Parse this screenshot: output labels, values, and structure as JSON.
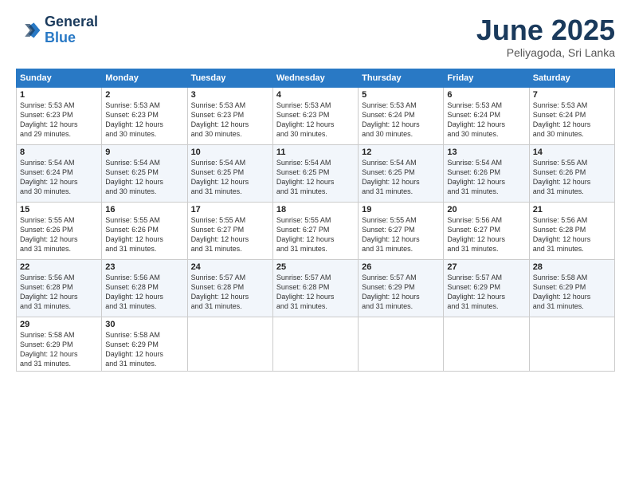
{
  "header": {
    "logo_line1": "General",
    "logo_line2": "Blue",
    "month": "June 2025",
    "location": "Peliyagoda, Sri Lanka"
  },
  "weekdays": [
    "Sunday",
    "Monday",
    "Tuesday",
    "Wednesday",
    "Thursday",
    "Friday",
    "Saturday"
  ],
  "weeks": [
    [
      {
        "day": "1",
        "info": "Sunrise: 5:53 AM\nSunset: 6:23 PM\nDaylight: 12 hours\nand 29 minutes."
      },
      {
        "day": "2",
        "info": "Sunrise: 5:53 AM\nSunset: 6:23 PM\nDaylight: 12 hours\nand 30 minutes."
      },
      {
        "day": "3",
        "info": "Sunrise: 5:53 AM\nSunset: 6:23 PM\nDaylight: 12 hours\nand 30 minutes."
      },
      {
        "day": "4",
        "info": "Sunrise: 5:53 AM\nSunset: 6:23 PM\nDaylight: 12 hours\nand 30 minutes."
      },
      {
        "day": "5",
        "info": "Sunrise: 5:53 AM\nSunset: 6:24 PM\nDaylight: 12 hours\nand 30 minutes."
      },
      {
        "day": "6",
        "info": "Sunrise: 5:53 AM\nSunset: 6:24 PM\nDaylight: 12 hours\nand 30 minutes."
      },
      {
        "day": "7",
        "info": "Sunrise: 5:53 AM\nSunset: 6:24 PM\nDaylight: 12 hours\nand 30 minutes."
      }
    ],
    [
      {
        "day": "8",
        "info": "Sunrise: 5:54 AM\nSunset: 6:24 PM\nDaylight: 12 hours\nand 30 minutes."
      },
      {
        "day": "9",
        "info": "Sunrise: 5:54 AM\nSunset: 6:25 PM\nDaylight: 12 hours\nand 30 minutes."
      },
      {
        "day": "10",
        "info": "Sunrise: 5:54 AM\nSunset: 6:25 PM\nDaylight: 12 hours\nand 31 minutes."
      },
      {
        "day": "11",
        "info": "Sunrise: 5:54 AM\nSunset: 6:25 PM\nDaylight: 12 hours\nand 31 minutes."
      },
      {
        "day": "12",
        "info": "Sunrise: 5:54 AM\nSunset: 6:25 PM\nDaylight: 12 hours\nand 31 minutes."
      },
      {
        "day": "13",
        "info": "Sunrise: 5:54 AM\nSunset: 6:26 PM\nDaylight: 12 hours\nand 31 minutes."
      },
      {
        "day": "14",
        "info": "Sunrise: 5:55 AM\nSunset: 6:26 PM\nDaylight: 12 hours\nand 31 minutes."
      }
    ],
    [
      {
        "day": "15",
        "info": "Sunrise: 5:55 AM\nSunset: 6:26 PM\nDaylight: 12 hours\nand 31 minutes."
      },
      {
        "day": "16",
        "info": "Sunrise: 5:55 AM\nSunset: 6:26 PM\nDaylight: 12 hours\nand 31 minutes."
      },
      {
        "day": "17",
        "info": "Sunrise: 5:55 AM\nSunset: 6:27 PM\nDaylight: 12 hours\nand 31 minutes."
      },
      {
        "day": "18",
        "info": "Sunrise: 5:55 AM\nSunset: 6:27 PM\nDaylight: 12 hours\nand 31 minutes."
      },
      {
        "day": "19",
        "info": "Sunrise: 5:55 AM\nSunset: 6:27 PM\nDaylight: 12 hours\nand 31 minutes."
      },
      {
        "day": "20",
        "info": "Sunrise: 5:56 AM\nSunset: 6:27 PM\nDaylight: 12 hours\nand 31 minutes."
      },
      {
        "day": "21",
        "info": "Sunrise: 5:56 AM\nSunset: 6:28 PM\nDaylight: 12 hours\nand 31 minutes."
      }
    ],
    [
      {
        "day": "22",
        "info": "Sunrise: 5:56 AM\nSunset: 6:28 PM\nDaylight: 12 hours\nand 31 minutes."
      },
      {
        "day": "23",
        "info": "Sunrise: 5:56 AM\nSunset: 6:28 PM\nDaylight: 12 hours\nand 31 minutes."
      },
      {
        "day": "24",
        "info": "Sunrise: 5:57 AM\nSunset: 6:28 PM\nDaylight: 12 hours\nand 31 minutes."
      },
      {
        "day": "25",
        "info": "Sunrise: 5:57 AM\nSunset: 6:28 PM\nDaylight: 12 hours\nand 31 minutes."
      },
      {
        "day": "26",
        "info": "Sunrise: 5:57 AM\nSunset: 6:29 PM\nDaylight: 12 hours\nand 31 minutes."
      },
      {
        "day": "27",
        "info": "Sunrise: 5:57 AM\nSunset: 6:29 PM\nDaylight: 12 hours\nand 31 minutes."
      },
      {
        "day": "28",
        "info": "Sunrise: 5:58 AM\nSunset: 6:29 PM\nDaylight: 12 hours\nand 31 minutes."
      }
    ],
    [
      {
        "day": "29",
        "info": "Sunrise: 5:58 AM\nSunset: 6:29 PM\nDaylight: 12 hours\nand 31 minutes."
      },
      {
        "day": "30",
        "info": "Sunrise: 5:58 AM\nSunset: 6:29 PM\nDaylight: 12 hours\nand 31 minutes."
      },
      {
        "day": "",
        "info": ""
      },
      {
        "day": "",
        "info": ""
      },
      {
        "day": "",
        "info": ""
      },
      {
        "day": "",
        "info": ""
      },
      {
        "day": "",
        "info": ""
      }
    ]
  ]
}
